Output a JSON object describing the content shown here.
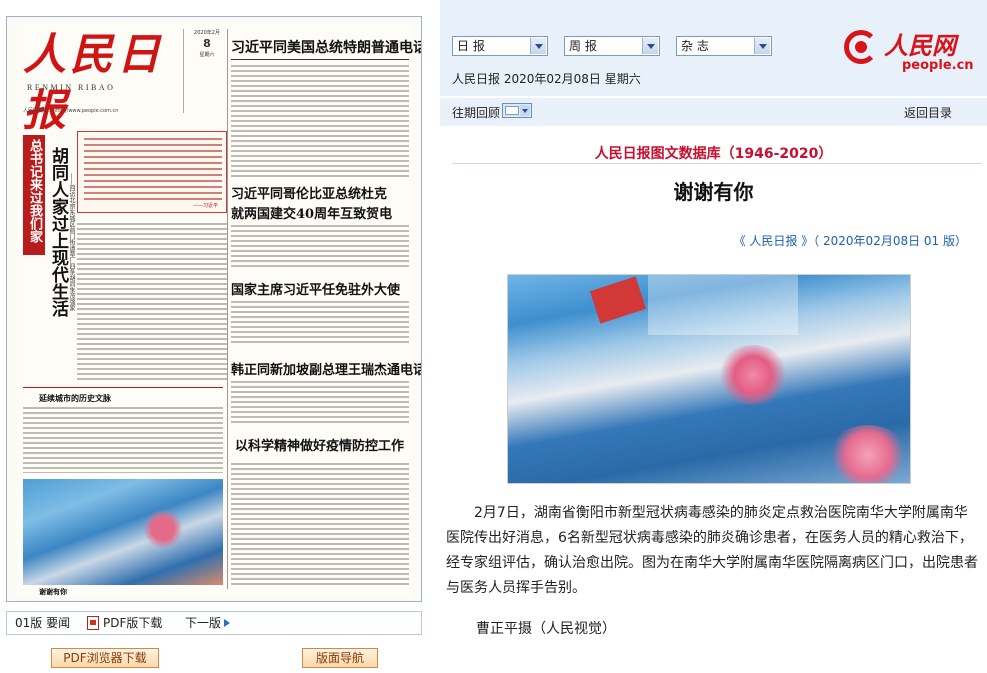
{
  "paper": {
    "masthead": "人民日报",
    "masthead_en": "RENMIN RIBAO",
    "masthead_sub": "人民网网址：http://www.people.com.cn",
    "issue_date": "2020年2月",
    "issue_day": "8",
    "issue_weekday": "星期六",
    "headline_1": "习近平同美国总统特朗普通电话",
    "headline_2a": "习近平同哥伦比亚总统杜克",
    "headline_2b": "就两国建交40周年互致贺电",
    "headline_3": "国家主席习近平任免驻外大使",
    "headline_4": "韩正同新加坡副总理王瑞杰通电话",
    "headline_5": "以科学精神做好疫情防控工作",
    "side_feature": "总书记来过我们家",
    "feature_title": "胡同人家过上现代生活",
    "feature_sub": "——回访北京东城区前门街道草厂四条胡同朱茂强家",
    "quote_sig": "——习近平",
    "section_label": "延续城市的历史文脉",
    "photo_caption": "谢谢有你"
  },
  "paper_nav": {
    "page": "01版 要闻",
    "pdf_label": "PDF版下载",
    "next_label": "下一版"
  },
  "buttons": {
    "pdf_browser": "PDF浏览器下载",
    "layout_nav": "版面导航"
  },
  "selects": {
    "daily": "日 报",
    "weekly": "周 报",
    "magazine": "杂 志"
  },
  "date_line": "人民日报 2020年02月08日 星期六",
  "logo": {
    "cn": "人民网",
    "en": "people.cn"
  },
  "archive_label": "往期回顾",
  "back_to_list": "返回目录",
  "db_title": "人民日报图文数据库（1946-2020）",
  "article": {
    "title": "谢谢有你",
    "meta": "《 人民日报 》（ 2020年02月08日   01 版）",
    "body": "2月7日，湖南省衡阳市新型冠状病毒感染的肺炎定点救治医院南华大学附属南华医院传出好消息，6名新型冠状病毒感染的肺炎确诊患者，在医务人员的精心救治下，经专家组评估，确认治愈出院。图为在南华大学附属南华医院隔离病区门口，出院患者与医务人员挥手告别。",
    "credit": "曹正平摄（人民视觉）"
  },
  "colors": {
    "brand_red": "#d8141b",
    "link_blue": "#1a5fb4",
    "bar_blue": "#e8f1fa"
  }
}
